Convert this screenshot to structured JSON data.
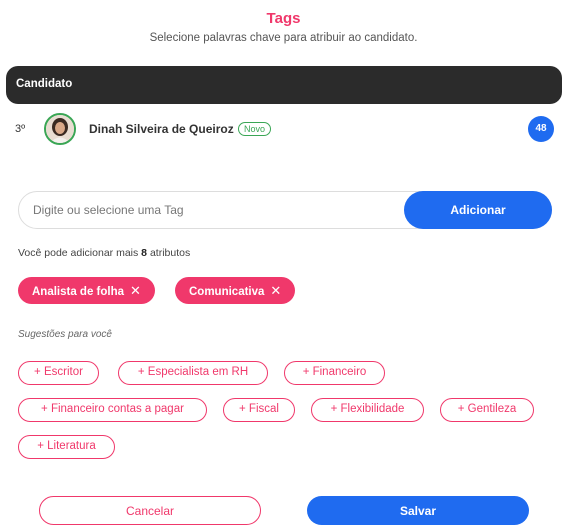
{
  "header": {
    "title": "Tags",
    "subtitle": "Selecione palavras chave para atribuir ao candidato."
  },
  "candidate_section": {
    "header_label": "Candidato",
    "candidate": {
      "rank": "3º",
      "name": "Dinah Silveira de Queiroz",
      "badge": "Novo",
      "score": "48"
    }
  },
  "tag_input": {
    "placeholder": "Digite ou selecione uma Tag",
    "value": "",
    "add_label": "Adicionar"
  },
  "remaining": {
    "prefix": "Você pode adicionar mais",
    "count": "8",
    "suffix": "atributos"
  },
  "selected_tags": [
    {
      "label": "Analista de folha",
      "remove_icon": "✕"
    },
    {
      "label": "Comunicativa",
      "remove_icon": "✕"
    }
  ],
  "suggestions": {
    "label": "Sugestões para você",
    "items": [
      "+ Escritor",
      "+ Especialista em RH",
      "+ Financeiro",
      "+ Financeiro contas a pagar",
      "+ Fiscal",
      "+ Flexibilidade",
      "+ Gentileza",
      "+ Literatura"
    ]
  },
  "footer": {
    "cancel_label": "Cancelar",
    "save_label": "Salvar"
  },
  "colors": {
    "accent_pink": "#f0386b",
    "primary_blue": "#1f6bf0",
    "header_dark": "#2b2b2b",
    "new_badge_green": "#3aa655"
  },
  "icons": {
    "avatar": "user-photo",
    "remove": "close-icon"
  }
}
